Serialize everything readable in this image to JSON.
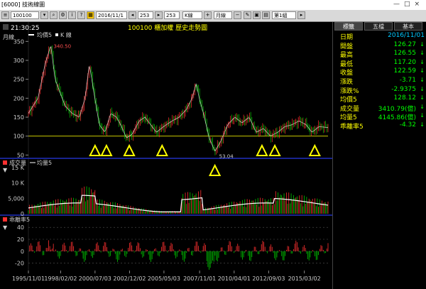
{
  "window": {
    "title": "[6000] 技術線圖",
    "controls": [
      "—",
      "□",
      "×"
    ]
  },
  "toolbar": {
    "symbol": "100100",
    "date": "2016/11/1",
    "count_a": "253",
    "count_b": "253",
    "chart_type": "K線",
    "period": "月線",
    "group": "第1組"
  },
  "chart": {
    "time": "21:30:25",
    "period_label": "月線",
    "symbol_title": "100100 櫃加權 歷史走勢圖",
    "legend_ma": "均價5",
    "legend_k": "K 線",
    "high_label": "340.50",
    "low_label": "53.04",
    "volume_title": "成交量",
    "volume_ma": "均量5",
    "bias_title": "乖離率5",
    "x_labels": [
      "1995/11/01",
      "1998/02/02",
      "2000/07/03",
      "2002/12/02",
      "2005/05/03",
      "2007/11/01",
      "2010/04/01",
      "2012/09/03",
      "2015/03/02"
    ],
    "price_ticks": [
      "350",
      "300",
      "250",
      "200",
      "150",
      "100",
      "50"
    ],
    "volume_ticks": [
      "15 K",
      "10 K",
      "5,000",
      "0"
    ],
    "bias_ticks": [
      "40",
      "20",
      "0",
      "-20"
    ],
    "colors": {
      "up": "#ff3030",
      "down": "#00c800",
      "ma": "#ffffff",
      "triangle": "#ffff00",
      "label": "#ffff00"
    }
  },
  "chart_data": {
    "type": "line",
    "title": "100100 櫃加權 歷史走勢圖",
    "x_range": [
      "1995/11/01",
      "2016/11/01"
    ],
    "price": {
      "ylim": [
        45,
        360
      ],
      "x": [
        1995.83,
        1996.5,
        1997.0,
        1997.4,
        1997.7,
        1998.0,
        1998.4,
        1998.9,
        1999.4,
        1999.8,
        2000.1,
        2000.4,
        2000.8,
        2001.2,
        2001.6,
        2002.0,
        2002.3,
        2002.7,
        2003.1,
        2003.6,
        2004.0,
        2004.4,
        2004.8,
        2005.3,
        2005.9,
        2006.4,
        2006.9,
        2007.3,
        2007.6,
        2007.8,
        2008.1,
        2008.5,
        2008.9,
        2009.3,
        2009.8,
        2010.3,
        2010.8,
        2011.3,
        2011.8,
        2012.3,
        2012.8,
        2013.3,
        2013.8,
        2014.3,
        2014.8,
        2015.3,
        2015.7,
        2016.2,
        2016.83
      ],
      "values": [
        160,
        200,
        290,
        340,
        250,
        220,
        180,
        160,
        150,
        200,
        290,
        220,
        130,
        110,
        160,
        150,
        130,
        95,
        105,
        140,
        150,
        130,
        110,
        125,
        140,
        150,
        170,
        200,
        240,
        200,
        160,
        95,
        60,
        85,
        130,
        150,
        135,
        150,
        110,
        120,
        100,
        110,
        125,
        130,
        140,
        130,
        110,
        125,
        122.59
      ]
    },
    "volume": {
      "ylim": [
        0,
        15000
      ],
      "ma5_at_end": 4145.86,
      "last": 3410.79
    },
    "bias5": {
      "ylim": [
        -30,
        45
      ],
      "last": -4.32
    },
    "annotations": {
      "max": 340.5,
      "min": 53.04
    }
  },
  "info": {
    "tabs": [
      "標籤",
      "五檔",
      "基本"
    ],
    "rows": [
      {
        "label": "日期",
        "value": "2016/11/01",
        "arrow": "",
        "color": "blue"
      },
      {
        "label": "開盤",
        "value": "126.27",
        "arrow": "↓"
      },
      {
        "label": "最高",
        "value": "126.55",
        "arrow": "↓"
      },
      {
        "label": "最低",
        "value": "117.20",
        "arrow": "↓"
      },
      {
        "label": "收盤",
        "value": "122.59",
        "arrow": "↓"
      },
      {
        "label": "漲跌",
        "value": "-3.71",
        "arrow": "↓"
      },
      {
        "label": "漲跌%",
        "value": "-2.9375",
        "arrow": "↓"
      },
      {
        "label": "均價5",
        "value": "128.12",
        "arrow": "↓"
      },
      {
        "label": "成交量",
        "value": "3410.79(億)",
        "arrow": "↓"
      },
      {
        "label": "均量5",
        "value": "4145.86(億)",
        "arrow": "↓"
      },
      {
        "label": "乖離率5",
        "value": "-4.32",
        "arrow": "↓"
      }
    ]
  }
}
